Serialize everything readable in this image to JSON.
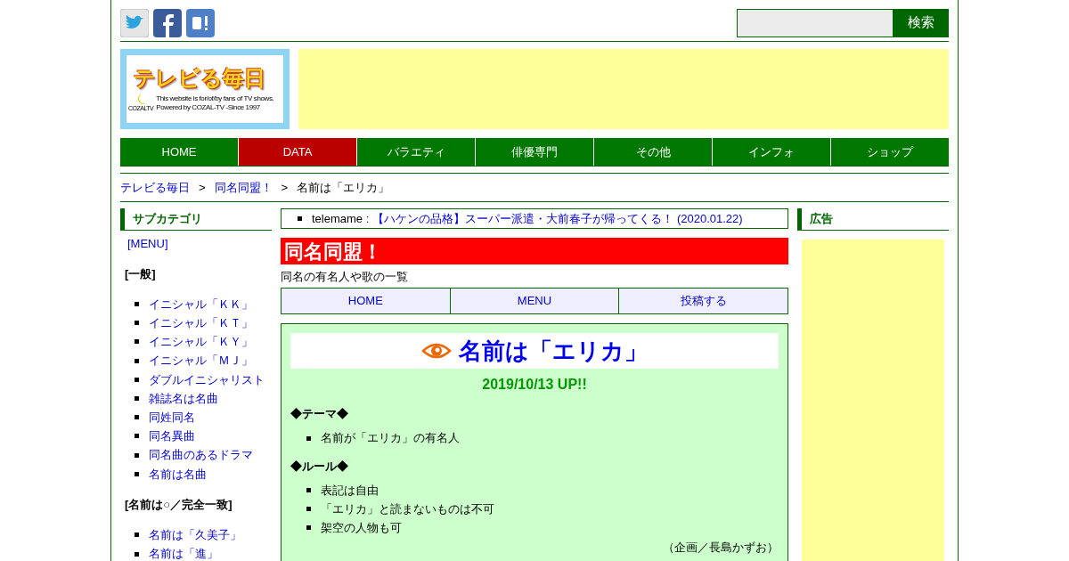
{
  "search": {
    "button": "検索"
  },
  "logo": {
    "title": "テレビる毎日",
    "tagline": [
      "This website is for/of/by fans of TV shows.",
      "Powered by COZAL-TV  -Since 1997"
    ],
    "brand": "COZALTV"
  },
  "nav": [
    {
      "label": "HOME",
      "selected": false
    },
    {
      "label": "DATA",
      "selected": true
    },
    {
      "label": "バラエティ",
      "selected": false
    },
    {
      "label": "俳優専門",
      "selected": false
    },
    {
      "label": "その他",
      "selected": false
    },
    {
      "label": "インフォ",
      "selected": false
    },
    {
      "label": "ショップ",
      "selected": false
    }
  ],
  "breadcrumb": [
    {
      "label": "テレビる毎日",
      "kind": "link"
    },
    {
      "label": ">",
      "kind": "separator"
    },
    {
      "label": "同名同盟！",
      "kind": "link"
    },
    {
      "label": ">",
      "kind": "separator"
    },
    {
      "label": "名前は「エリカ」",
      "kind": "current"
    }
  ],
  "sidebar": {
    "heading": "サブカテゴリ",
    "menu": "[MENU]",
    "groups": [
      {
        "title": "[一般]",
        "items": [
          "イニシャル「ＫＫ」",
          "イニシャル「ＫＴ」",
          "イニシャル「ＫＹ」",
          "イニシャル「ＭＪ」",
          "ダブルイニシャリスト",
          "雑誌名は名曲",
          "同姓同名",
          "同名異曲",
          "同名曲のあるドラマ",
          "名前は名曲"
        ]
      },
      {
        "title": "[名前は○／完全一致]",
        "items": [
          "名前は「久美子」",
          "名前は「進」"
        ]
      }
    ]
  },
  "news": {
    "source": "telemame :",
    "link": "【ハケンの品格】スーパー派遣・大前春子が帰ってくる！ (2020.01.22)"
  },
  "section": {
    "banner": "同名同盟！",
    "description": "同名の有名人や歌の一覧",
    "tabs": [
      "HOME",
      "MENU",
      "投稿する"
    ]
  },
  "article": {
    "title": "名前は「エリカ」",
    "date": "2019/10/13 UP!!",
    "blocks": [
      {
        "heading": "◆テーマ◆",
        "items": [
          "名前が「エリカ」の有名人"
        ]
      },
      {
        "heading": "◆ルール◆",
        "items": [
          "表記は自由",
          "「エリカ」と読まないものは不可",
          "架空の人物も可"
        ]
      }
    ],
    "credit": "（企画／長島かずお）"
  },
  "ads": {
    "heading": "広告"
  }
}
